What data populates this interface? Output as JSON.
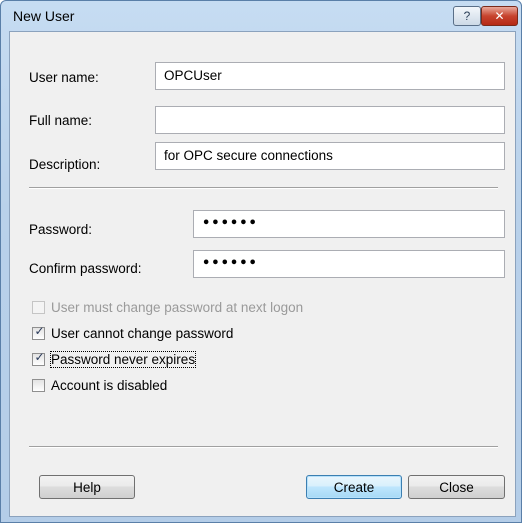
{
  "window": {
    "title": "New User",
    "help_glyph": "?",
    "close_glyph": "✕"
  },
  "form": {
    "username_label": "User name:",
    "username_value": "OPCUser",
    "fullname_label": "Full name:",
    "fullname_value": "",
    "description_label": "Description:",
    "description_value": "for OPC secure connections",
    "password_label": "Password:",
    "password_value": "••••••",
    "confirm_label": "Confirm password:",
    "confirm_value": "••••••"
  },
  "options": [
    {
      "label": "User must change password at next logon",
      "checked": false,
      "enabled": false
    },
    {
      "label": "User cannot change password",
      "checked": true,
      "enabled": true
    },
    {
      "label": "Password never expires",
      "checked": true,
      "enabled": true,
      "focused": true
    },
    {
      "label": "Account is disabled",
      "checked": false,
      "enabled": true
    }
  ],
  "check_glyph": "✓",
  "buttons": {
    "help": "Help",
    "create": "Create",
    "close": "Close"
  }
}
